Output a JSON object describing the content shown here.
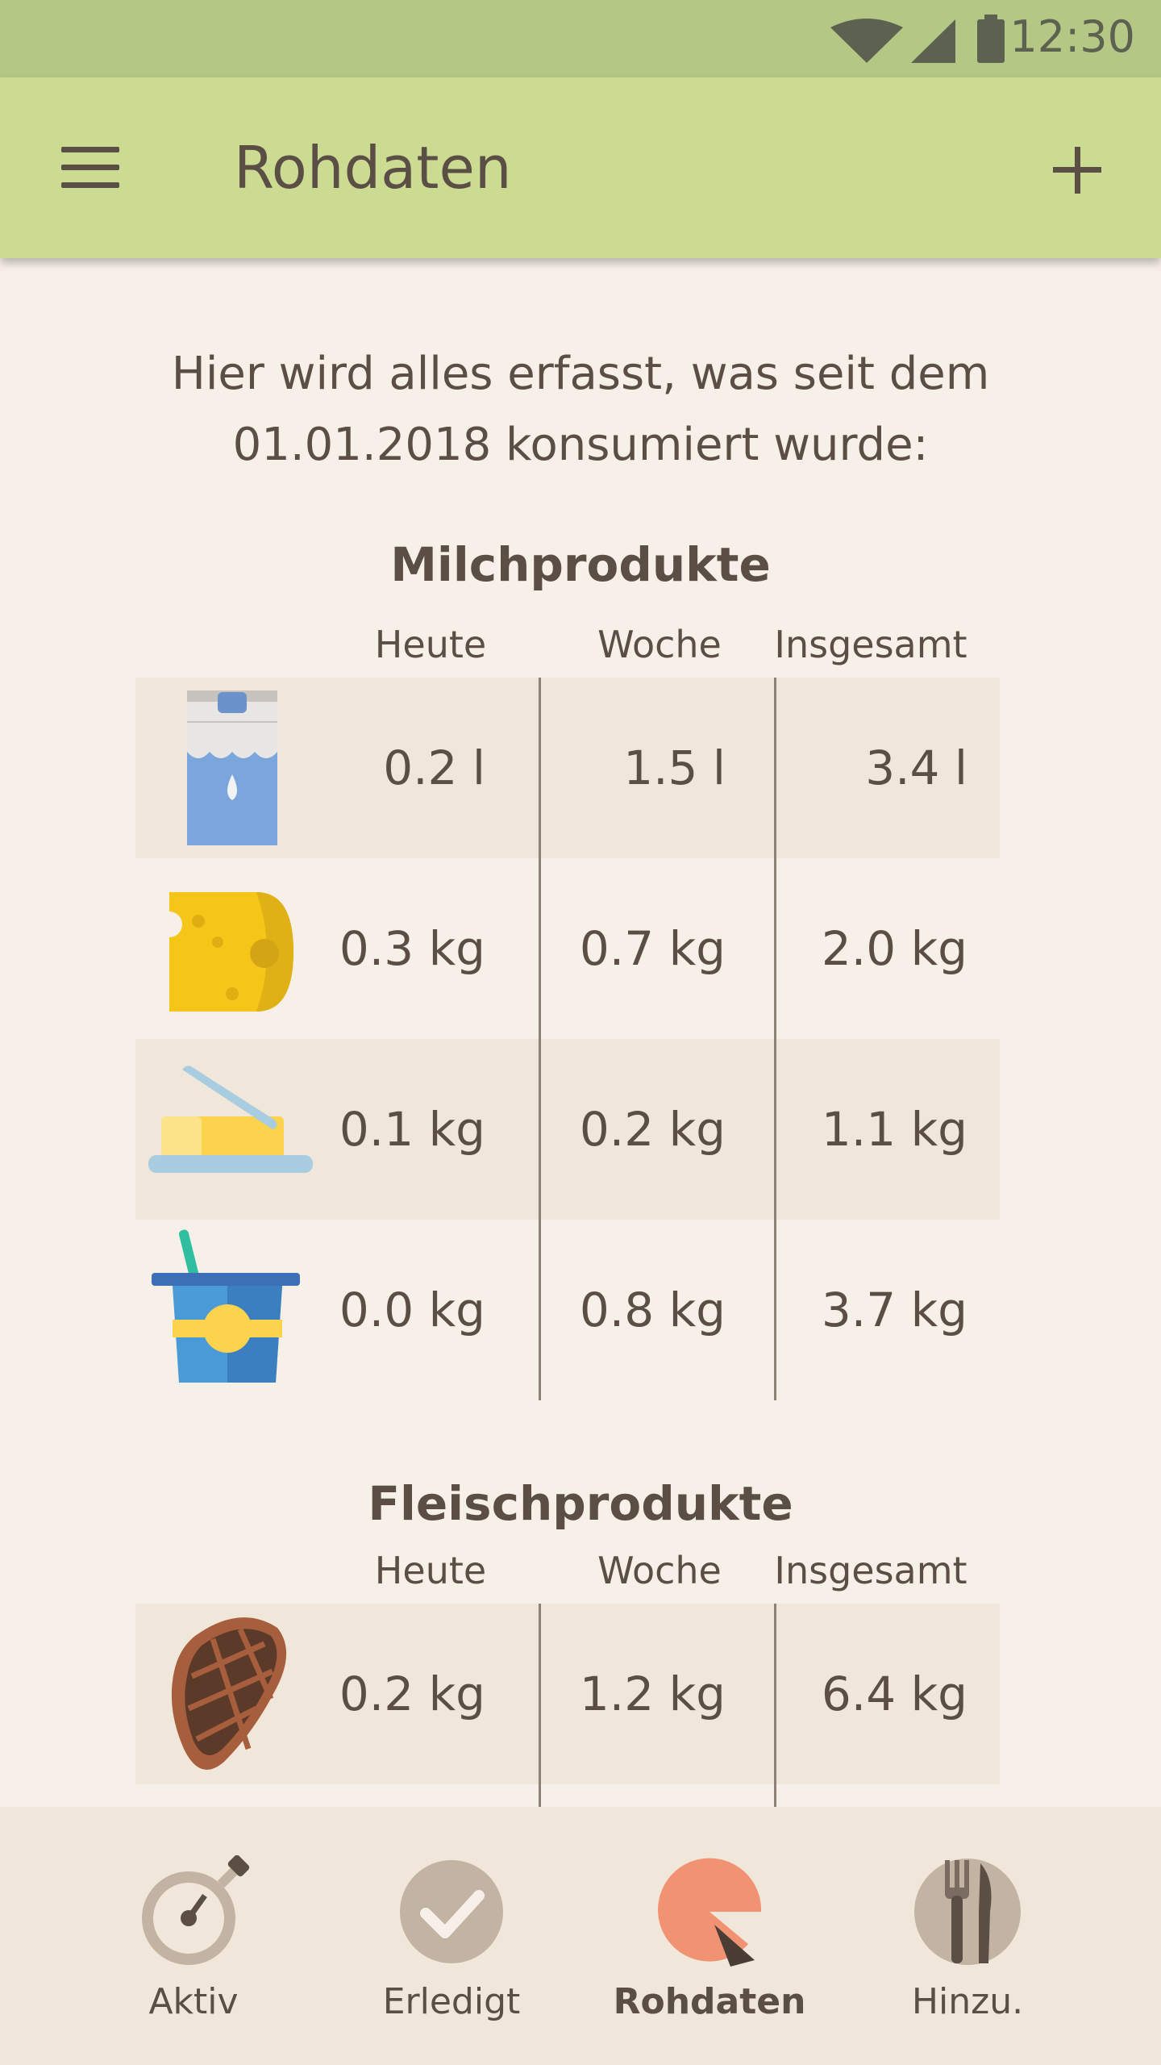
{
  "status": {
    "time": "12:30"
  },
  "appbar": {
    "title": "Rohdaten"
  },
  "intro": {
    "line1": "Hier wird alles erfasst, was seit dem",
    "line2": "01.01.2018 konsumiert wurde:"
  },
  "columns": {
    "today": "Heute",
    "week": "Woche",
    "total": "Insgesamt"
  },
  "dairy": {
    "title": "Milchprodukte",
    "rows": [
      {
        "icon": "milk-carton-icon",
        "today": "0.2 l",
        "week": "1.5 l",
        "total": "3.4 l"
      },
      {
        "icon": "cheese-icon",
        "today": "0.3 kg",
        "week": "0.7 kg",
        "total": "2.0 kg"
      },
      {
        "icon": "butter-icon",
        "today": "0.1 kg",
        "week": "0.2 kg",
        "total": "1.1 kg"
      },
      {
        "icon": "yogurt-icon",
        "today": "0.0 kg",
        "week": "0.8 kg",
        "total": "3.7 kg"
      }
    ]
  },
  "meat": {
    "title": "Fleischprodukte",
    "rows": [
      {
        "icon": "steak-icon",
        "today": "0.2 kg",
        "week": "1.2 kg",
        "total": "6.4 kg"
      }
    ]
  },
  "nav": {
    "items": [
      {
        "label": "Aktiv",
        "icon": "stopwatch-icon"
      },
      {
        "label": "Erledigt",
        "icon": "checkmark-icon"
      },
      {
        "label": "Rohdaten",
        "icon": "pie-chart-icon",
        "active": true
      },
      {
        "label": "Hinzu.",
        "icon": "cutlery-icon"
      }
    ]
  },
  "colors": {
    "statusbar": "#b5c785",
    "appbar": "#cbdb91",
    "background": "#f7f0e8",
    "row_shade": "#f0e6da",
    "accent": "#f19373",
    "text": "#5b4f45"
  }
}
